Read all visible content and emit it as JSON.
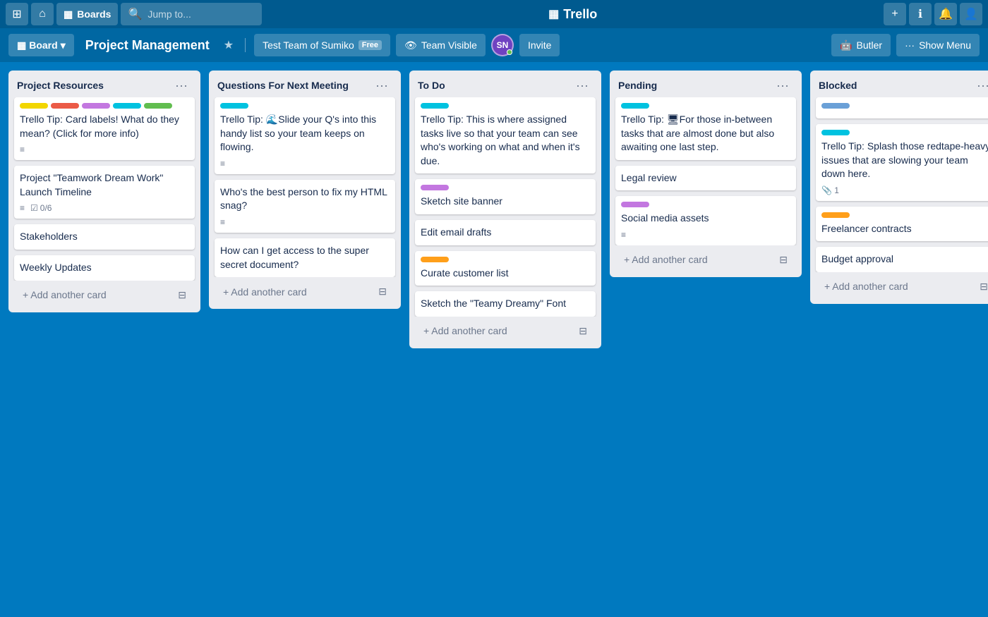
{
  "topNav": {
    "appsIcon": "⊞",
    "homeIcon": "⌂",
    "boardsLabel": "Boards",
    "searchPlaceholder": "Jump to...",
    "logoText": "Trello",
    "addIcon": "+",
    "infoIcon": "ℹ",
    "notifIcon": "🔔",
    "profileIcon": "👤"
  },
  "boardHeader": {
    "boardLabel": "Board",
    "title": "Project Management",
    "starIcon": "★",
    "teamLabel": "Test Team of Sumiko",
    "teamBadge": "Free",
    "visibilityIcon": "👁",
    "visibilityLabel": "Team Visible",
    "avatarText": "SN",
    "inviteLabel": "Invite",
    "butlerIcon": "🤖",
    "butlerLabel": "Butler",
    "menuDots": "···",
    "showMenuLabel": "Show Menu"
  },
  "lists": [
    {
      "id": "project-resources",
      "title": "Project Resources",
      "cards": [
        {
          "id": "tip-card-1",
          "labels": [
            {
              "color": "yellow"
            },
            {
              "color": "red"
            },
            {
              "color": "purple"
            },
            {
              "color": "teal"
            },
            {
              "color": "green"
            }
          ],
          "text": "Trello Tip: Card labels! What do they mean? (Click for more info)",
          "hasDescription": true
        },
        {
          "id": "teamwork-card",
          "text": "Project \"Teamwork Dream Work\" Launch Timeline",
          "hasDescription": true,
          "hasChecklist": true,
          "checklistText": "0/6"
        },
        {
          "id": "stakeholders-card",
          "text": "Stakeholders"
        },
        {
          "id": "weekly-updates-card",
          "text": "Weekly Updates"
        }
      ],
      "addCardLabel": "+ Add another card"
    },
    {
      "id": "questions-next-meeting",
      "title": "Questions For Next Meeting",
      "cards": [
        {
          "id": "tip-card-2",
          "labels": [
            {
              "color": "teal"
            }
          ],
          "text": "Trello Tip: 🌊Slide your Q's into this handy list so your team keeps on flowing.",
          "hasDescription": true
        },
        {
          "id": "html-snag-card",
          "text": "Who's the best person to fix my HTML snag?",
          "hasDescription": true
        },
        {
          "id": "secret-doc-card",
          "text": "How can I get access to the super secret document?"
        }
      ],
      "addCardLabel": "+ Add another card"
    },
    {
      "id": "to-do",
      "title": "To Do",
      "cards": [
        {
          "id": "tip-card-3",
          "labels": [
            {
              "color": "teal"
            }
          ],
          "text": "Trello Tip: This is where assigned tasks live so that your team can see who's working on what and when it's due."
        },
        {
          "id": "sketch-banner-card",
          "labels": [
            {
              "color": "purple"
            }
          ],
          "text": "Sketch site banner"
        },
        {
          "id": "email-drafts-card",
          "text": "Edit email drafts"
        },
        {
          "id": "curate-customer-card",
          "labels": [
            {
              "color": "orange"
            }
          ],
          "text": "Curate customer list"
        },
        {
          "id": "sketch-font-card",
          "text": "Sketch the \"Teamy Dreamy\" Font"
        }
      ],
      "addCardLabel": "+ Add another card"
    },
    {
      "id": "pending",
      "title": "Pending",
      "cards": [
        {
          "id": "tip-card-4",
          "labels": [
            {
              "color": "teal"
            }
          ],
          "text": "Trello Tip: 🖥For those in-between tasks that are almost done but also awaiting one last step."
        },
        {
          "id": "legal-review-card",
          "text": "Legal review"
        },
        {
          "id": "social-media-card",
          "labels": [
            {
              "color": "purple"
            }
          ],
          "text": "Social media assets",
          "hasDescription": true
        }
      ],
      "addCardLabel": "+ Add another card"
    },
    {
      "id": "blocked",
      "title": "Blocked",
      "cards": [
        {
          "id": "blocked-blue-card",
          "labels": [
            {
              "color": "blue"
            }
          ],
          "text": ""
        },
        {
          "id": "tip-card-5",
          "labels": [
            {
              "color": "teal"
            }
          ],
          "text": "Trello Tip: Splash those redtape-heavy issues that are slowing your team down here.",
          "attachmentCount": 1
        },
        {
          "id": "freelancer-card",
          "labels": [
            {
              "color": "orange"
            }
          ],
          "text": "Freelancer contracts"
        },
        {
          "id": "budget-card",
          "text": "Budget approval"
        }
      ],
      "addCardLabel": "+ Add another card"
    }
  ],
  "labelColors": {
    "yellow": "#F2D600",
    "red": "#EB5A46",
    "purple": "#C377E0",
    "teal": "#00C2E0",
    "green": "#61BD4F",
    "orange": "#FF9F1A",
    "blue": "#6AA0D7"
  }
}
